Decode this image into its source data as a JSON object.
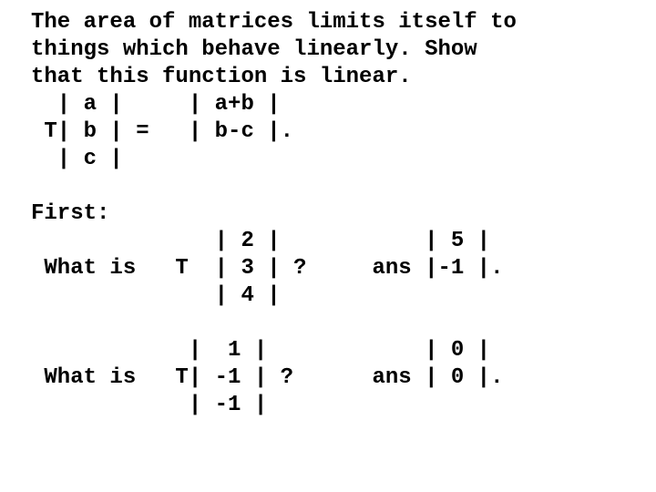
{
  "lines": {
    "l0": "The area of matrices limits itself to",
    "l1": "things which behave linearly. Show",
    "l2": "that this function is linear.",
    "l3": "  | a |     | a+b |",
    "l4": " T| b | =   | b-c |.",
    "l5": "  | c |",
    "l6": "",
    "l7": "First:",
    "l8": "              | 2 |           | 5 |",
    "l9": " What is   T  | 3 | ?     ans |-1 |.",
    "l10": "              | 4 |",
    "l11": "",
    "l12": "            |  1 |            | 0 |",
    "l13": " What is   T| -1 | ?      ans | 0 |.",
    "l14": "            | -1 |"
  }
}
